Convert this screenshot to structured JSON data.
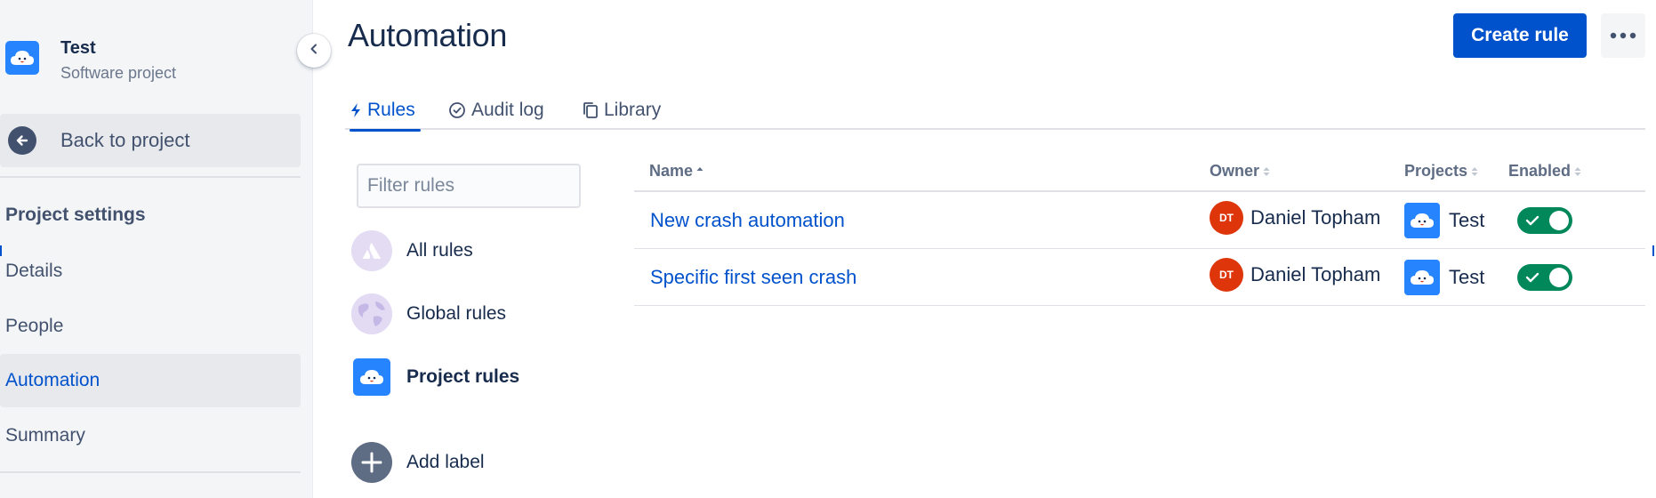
{
  "sidebar": {
    "project_name": "Test",
    "project_type": "Software project",
    "back_label": "Back to project",
    "section_title": "Project settings",
    "items": [
      {
        "label": "Details",
        "active": false
      },
      {
        "label": "People",
        "active": false
      },
      {
        "label": "Automation",
        "active": true
      },
      {
        "label": "Summary",
        "active": false
      }
    ]
  },
  "header": {
    "title": "Automation",
    "create_label": "Create rule"
  },
  "tabs": [
    {
      "label": "Rules",
      "icon": "lightning-icon",
      "active": true
    },
    {
      "label": "Audit log",
      "icon": "check-circle-icon",
      "active": false
    },
    {
      "label": "Library",
      "icon": "copy-icon",
      "active": false
    }
  ],
  "filter": {
    "placeholder": "Filter rules"
  },
  "categories": [
    {
      "label": "All rules",
      "icon": "atlassian-logo-icon",
      "bold": false
    },
    {
      "label": "Global rules",
      "icon": "globe-icon",
      "bold": false
    },
    {
      "label": "Project rules",
      "icon": "project-cloud-icon",
      "bold": true
    },
    {
      "label": "Add label",
      "icon": "plus-icon",
      "bold": false
    }
  ],
  "table": {
    "columns": [
      "Name",
      "Owner",
      "Projects",
      "Enabled"
    ],
    "rows": [
      {
        "name": "New crash automation",
        "owner_initials": "DT",
        "owner": "Daniel Topham",
        "project": "Test",
        "enabled": true
      },
      {
        "name": "Specific first seen crash",
        "owner_initials": "DT",
        "owner": "Daniel Topham",
        "project": "Test",
        "enabled": true
      }
    ]
  },
  "colors": {
    "primary": "#0052cc",
    "project_icon": "#2684ff",
    "owner_avatar": "#de350b",
    "toggle_on": "#00875a",
    "sidebar_bg": "#f4f5f7"
  }
}
